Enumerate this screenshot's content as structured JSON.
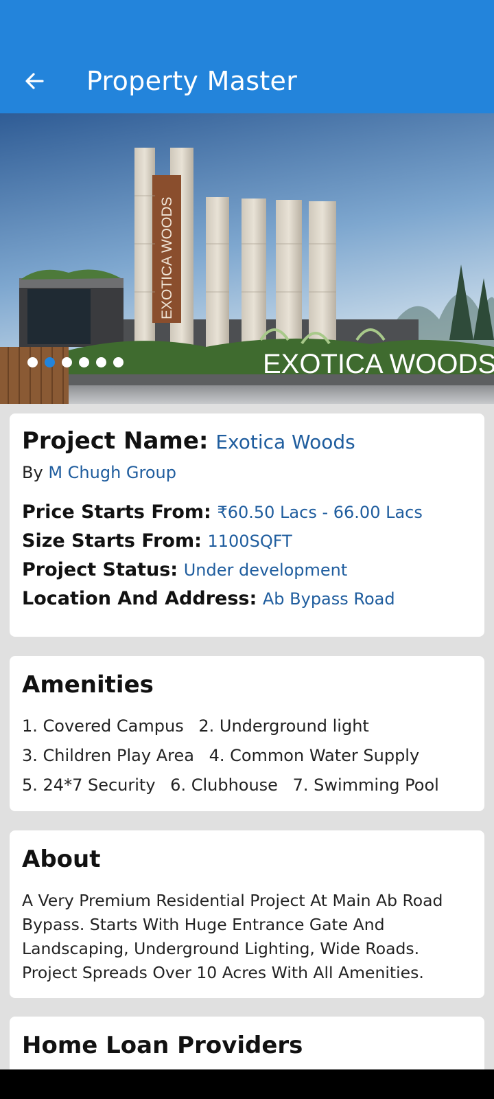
{
  "app_bar": {
    "title": "Property Master",
    "back_icon": "arrow-left-icon",
    "color": "#2384db"
  },
  "hero": {
    "gate_sign_text": "EXOTICA WOODS",
    "banner_text": "EXOTICA WOODS",
    "carousel": {
      "count": 6,
      "active_index": 1
    }
  },
  "project": {
    "name_label": "Project Name:",
    "name_value": "Exotica Woods",
    "by_label": "By",
    "by_value": "M Chugh Group",
    "price_label": "Price Starts From:",
    "price_value": "₹60.50 Lacs - 66.00 Lacs",
    "size_label": "Size Starts From:",
    "size_value": "1100SQFT",
    "status_label": "Project Status:",
    "status_value": "Under development",
    "location_label": "Location And Address:",
    "location_value": "Ab Bypass Road"
  },
  "amenities": {
    "title": "Amenities",
    "items": [
      "1. Covered Campus",
      "2. Underground light",
      "3. Children Play Area",
      "4. Common Water Supply",
      "5. 24*7 Security",
      "6. Clubhouse",
      "7. Swimming Pool"
    ]
  },
  "about": {
    "title": "About",
    "text": "A Very Premium Residential Project At Main Ab Road Bypass. Starts With Huge Entrance Gate And Landscaping, Underground Lighting, Wide Roads. Project Spreads Over 10 Acres With All Amenities."
  },
  "home_loan": {
    "title": "Home Loan Providers"
  }
}
